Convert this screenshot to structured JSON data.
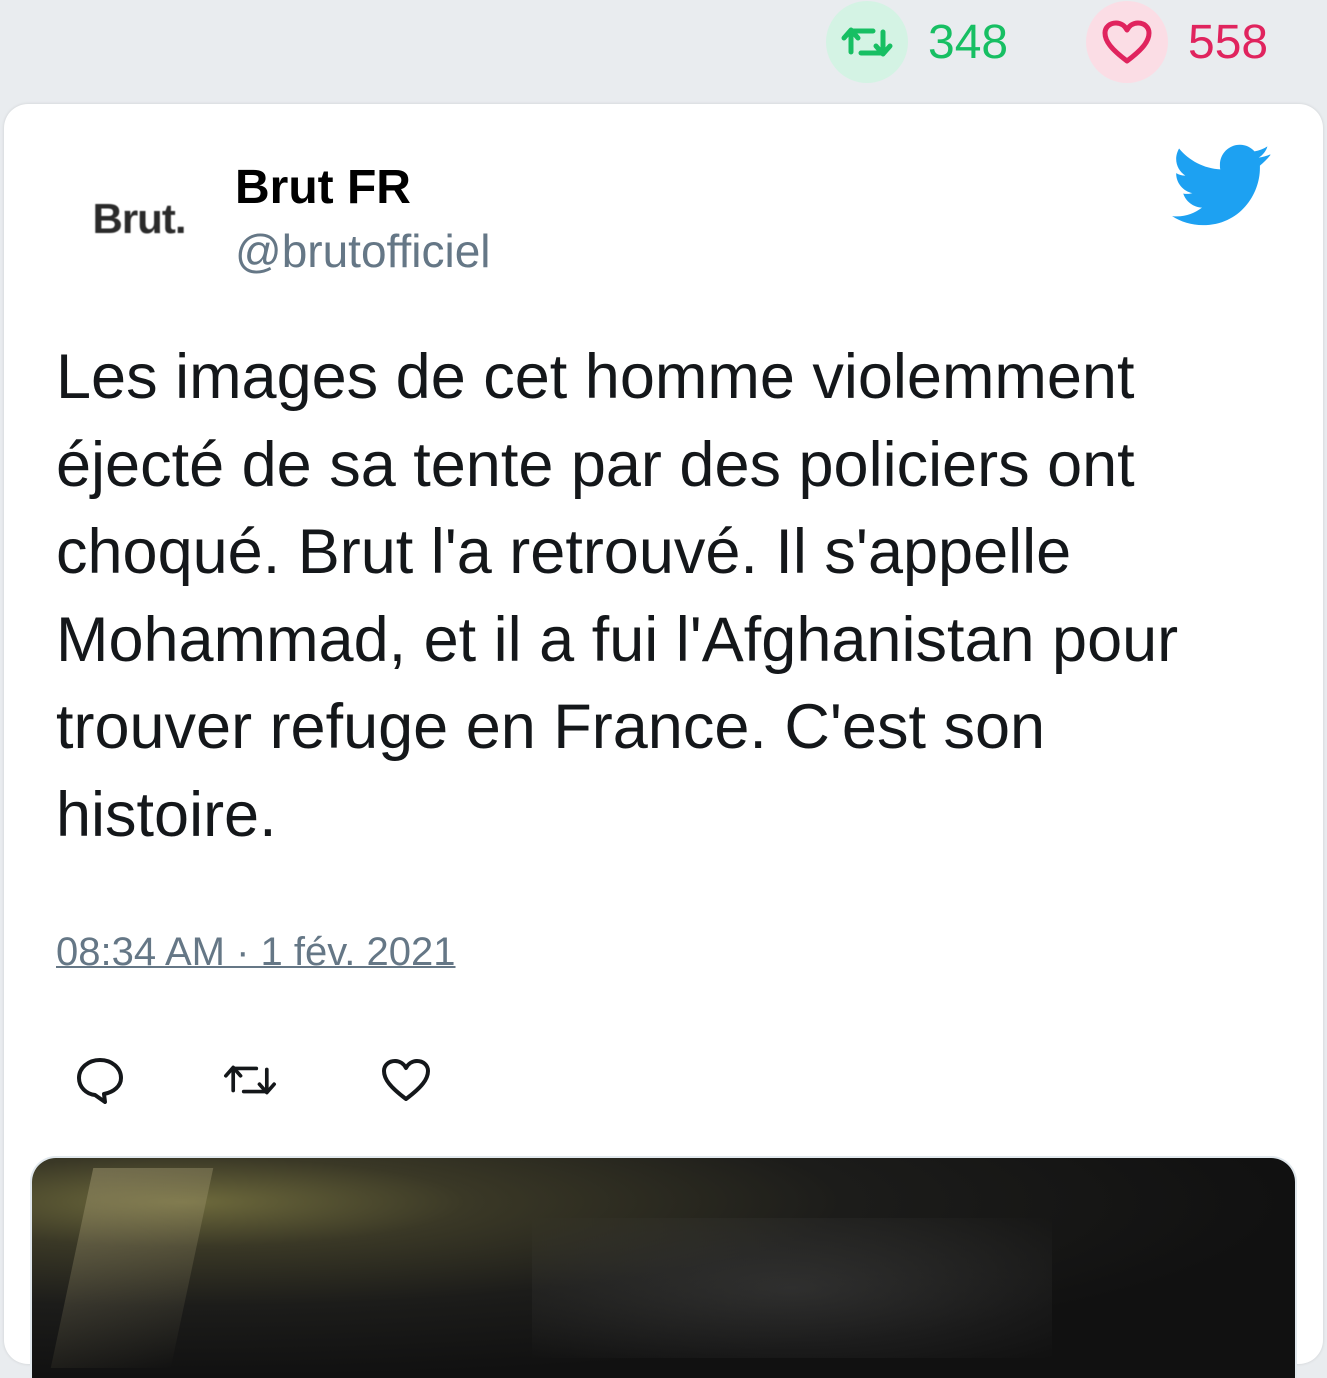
{
  "stats": {
    "retweet_count": "348",
    "like_count": "558"
  },
  "tweet": {
    "avatar_text": "Brut.",
    "display_name": "Brut FR",
    "handle": "@brutofficiel",
    "text": "Les images de cet homme violemment éjecté de sa tente par des policiers ont choqué. Brut l'a retrouvé. Il s'appelle Mohammad, et il a fui l'Afghanistan pour trouver refuge en France. C'est son histoire.",
    "timestamp": "08:34 AM · 1 fév. 2021"
  },
  "icons": {
    "retweet": "retweet-icon",
    "like": "heart-icon",
    "reply": "reply-icon",
    "brand": "twitter-bird-icon"
  },
  "colors": {
    "retweet": "#17bf63",
    "like": "#e0245e",
    "twitter_blue": "#1da1f2",
    "secondary_text": "#657786"
  }
}
